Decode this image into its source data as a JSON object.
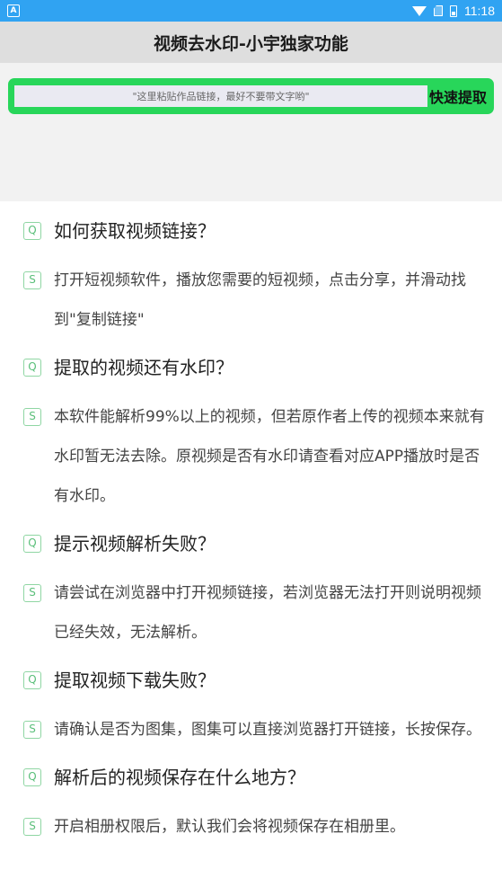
{
  "status": {
    "app_icon": "A",
    "time": "11:18",
    "icons": [
      "wifi-icon",
      "sim-icon",
      "battery-icon"
    ]
  },
  "title": "视频去水印-小宇独家功能",
  "search": {
    "placeholder": "\"这里粘贴作品链接，最好不要带文字哟\"",
    "value": "",
    "button_label": "快速提取"
  },
  "faq": [
    {
      "q_badge": "Q",
      "question": "如何获取视频链接？",
      "a_badge": "S",
      "answer": "打开短视频软件，播放您需要的短视频，点击分享，并滑动找到\"复制链接\""
    },
    {
      "q_badge": "Q",
      "question": "提取的视频还有水印？",
      "a_badge": "S",
      "answer": "本软件能解析99%以上的视频，但若原作者上传的视频本来就有水印暂无法去除。原视频是否有水印请查看对应APP播放时是否有水印。"
    },
    {
      "q_badge": "Q",
      "question": "提示视频解析失败？",
      "a_badge": "S",
      "answer": "请尝试在浏览器中打开视频链接，若浏览器无法打开则说明视频已经失效，无法解析。"
    },
    {
      "q_badge": "Q",
      "question": "提取视频下载失败？",
      "a_badge": "S",
      "answer": "请确认是否为图集，图集可以直接浏览器打开链接，长按保存。"
    },
    {
      "q_badge": "Q",
      "question": "解析后的视频保存在什么地方？",
      "a_badge": "S",
      "answer": "开启相册权限后，默认我们会将视频保存在相册里。"
    }
  ],
  "colors": {
    "statusbar": "#30a3f2",
    "accent_green": "#28d65a",
    "badge_green": "#5bbf7a"
  }
}
